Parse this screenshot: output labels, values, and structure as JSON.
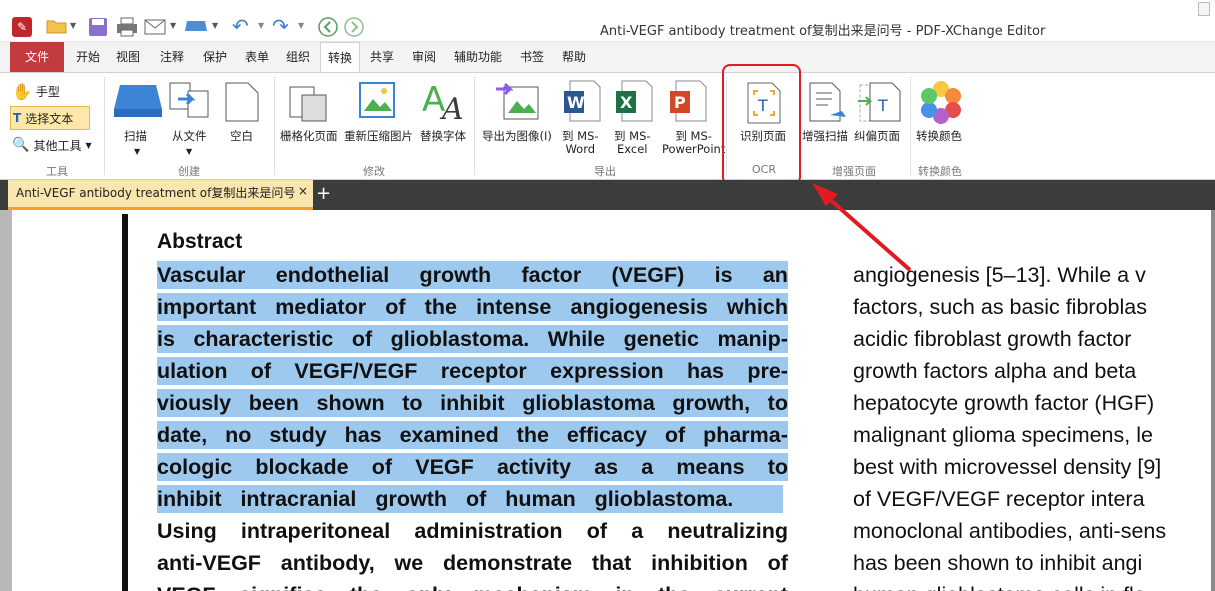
{
  "window": {
    "title": "Anti-VEGF antibody treatment of复制出来是问号 - PDF-XChange Editor"
  },
  "tabs": [
    {
      "label": "文件"
    },
    {
      "label": "开始"
    },
    {
      "label": "视图"
    },
    {
      "label": "注释"
    },
    {
      "label": "保护"
    },
    {
      "label": "表单"
    },
    {
      "label": "组织"
    },
    {
      "label": "转换"
    },
    {
      "label": "共享"
    },
    {
      "label": "审阅"
    },
    {
      "label": "辅助功能"
    },
    {
      "label": "书签"
    },
    {
      "label": "帮助"
    }
  ],
  "ribbon": {
    "tools": {
      "hand": "手型",
      "select_text": "选择文本",
      "other_tools": "其他工具",
      "group": "工具"
    },
    "create": {
      "scan": "扫描",
      "from_file": "从文件",
      "blank": "空白",
      "group": "创建"
    },
    "modify": {
      "rasterize": "栅格化页面",
      "recompress": "重新压缩图片",
      "replace_fonts": "替换字体",
      "group": "修改"
    },
    "export": {
      "to_image": "导出为图像(I)",
      "to_word_1": "到 MS-",
      "to_word_2": "Word",
      "to_excel_1": "到 MS-",
      "to_excel_2": "Excel",
      "to_ppt_1": "到 MS-",
      "to_ppt_2": "PowerPoint",
      "group": "导出"
    },
    "ocr": {
      "recognize": "识别页面",
      "group": "OCR"
    },
    "enhance": {
      "enhance_scan": "增强扫描",
      "deskew": "纠偏页面",
      "group": "增强页面"
    },
    "color": {
      "convert_colors": "转换颜色",
      "group": "转换颜色"
    }
  },
  "document_tab": {
    "label": "Anti-VEGF antibody treatment of复制出来是问号",
    "close": "×",
    "add": "+"
  },
  "document": {
    "heading": "Abstract",
    "left_lines": [
      "Vascular endothelial growth factor (VEGF) is an",
      "important mediator of the intense angiogenesis which",
      "is characteristic of glioblastoma. While genetic manip-",
      "ulation of VEGF/VEGF receptor expression has pre-",
      "viously been shown to inhibit glioblastoma growth, to",
      "date, no study has examined the efficacy of pharma-",
      "cologic blockade of VEGF activity as a means to",
      "inhibit intracranial growth of human glioblastoma.",
      "Using intraperitoneal administration of a neutralizing",
      "anti-VEGF antibody, we demonstrate that inhibition of",
      "VEGF signifies the only mechanism in the current"
    ],
    "right_lines": [
      "angiogenesis [5–13]. While a v",
      "factors, such as basic fibroblas",
      "acidic fibroblast growth factor",
      "growth factors alpha and beta",
      "hepatocyte growth factor (HGF)",
      "malignant glioma specimens, le",
      "best with microvessel density [9]",
      "of VEGF/VEGF receptor intera",
      "monoclonal antibodies, anti-sens",
      "has been shown to inhibit angi",
      "human glioblastoma cells in fla"
    ]
  },
  "colors": {
    "file_tab": "#c23b3f",
    "selection": "#9ec9ef",
    "annotation": "#e11b22",
    "doc_tab": "#f8e6ae"
  }
}
